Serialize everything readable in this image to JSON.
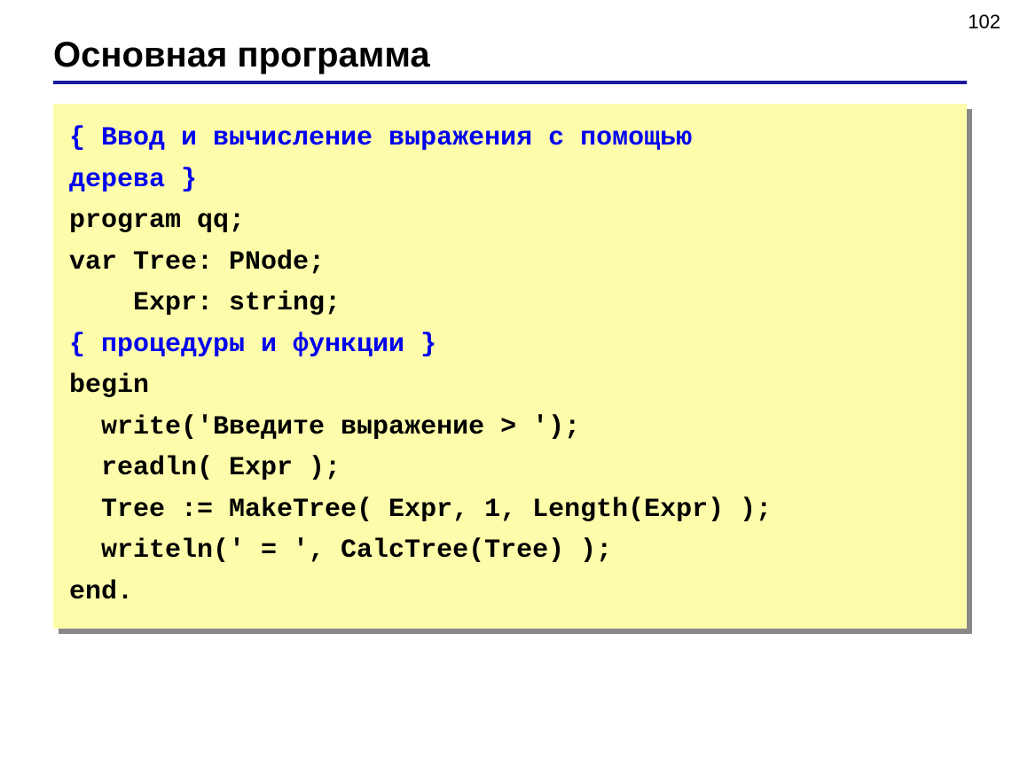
{
  "page_number": "102",
  "title": "Основная программа",
  "code": {
    "c1a": "{ Ввод и вычисление выражения с помощью",
    "c1b": "дерева }",
    "l1": "program qq;",
    "l2": "var Tree: PNode;",
    "l3": "    Expr: string;",
    "c2": "{ процедуры и функции }",
    "l4": "begin",
    "l5": "  write('Введите выражение > ');",
    "l6": "  readln( Expr );",
    "l7": "  Tree := MakeTree( Expr, 1, Length(Expr) );",
    "l8": "  writeln(' = ', CalcTree(Tree) );",
    "l9": "end."
  }
}
